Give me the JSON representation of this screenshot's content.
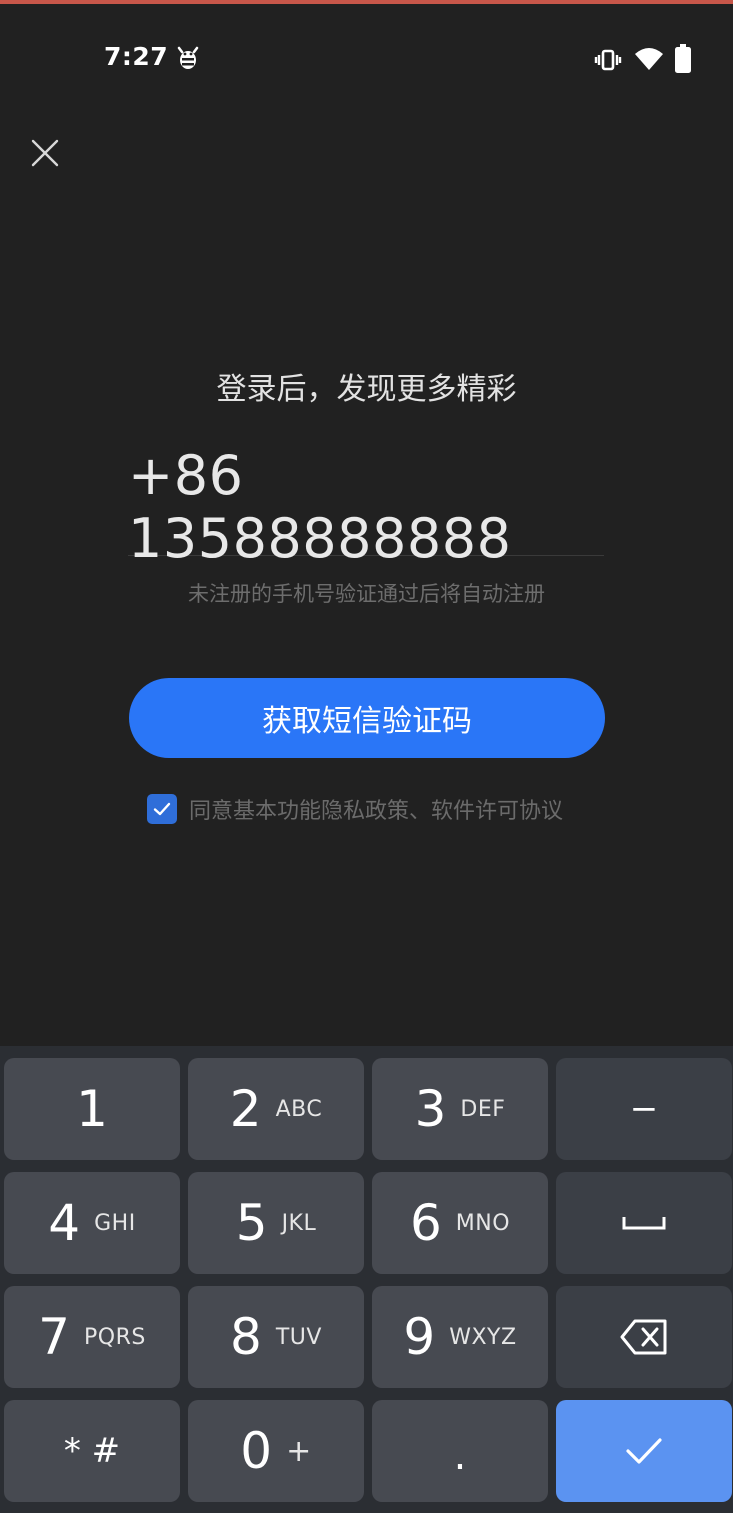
{
  "status_bar": {
    "time": "7:27",
    "icons": [
      "debug-icon",
      "vibrate-icon",
      "wifi-icon",
      "battery-icon"
    ]
  },
  "close": {
    "icon": "close-icon"
  },
  "login": {
    "headline": "登录后，发现更多精彩",
    "phone_value": "+86 13588888888",
    "hint": "未注册的手机号验证通过后将自动注册",
    "sms_button_label": "获取短信验证码",
    "agreement_checked": true,
    "agreement_text": "同意基本功能隐私政策、软件许可协议"
  },
  "colors": {
    "background": "#212121",
    "accent": "#2a76f7",
    "checkbox": "#2f6ed9",
    "keyboard_bg": "#2b2e33",
    "key": "#474a51",
    "key_fn": "#3b3f46",
    "key_done": "#5b93f1"
  },
  "keyboard": {
    "keys": [
      {
        "num": "1",
        "letters": ""
      },
      {
        "num": "2",
        "letters": "ABC"
      },
      {
        "num": "3",
        "letters": "DEF"
      },
      {
        "sym": "−"
      },
      {
        "num": "4",
        "letters": "GHI"
      },
      {
        "num": "5",
        "letters": "JKL"
      },
      {
        "num": "6",
        "letters": "MNO"
      },
      {
        "sym": "space-icon"
      },
      {
        "num": "7",
        "letters": "PQRS"
      },
      {
        "num": "8",
        "letters": "TUV"
      },
      {
        "num": "9",
        "letters": "WXYZ"
      },
      {
        "sym": "backspace-icon"
      },
      {
        "sym": "* #"
      },
      {
        "num": "0",
        "letters": "+"
      },
      {
        "sym": "."
      },
      {
        "sym": "check-icon"
      }
    ]
  }
}
